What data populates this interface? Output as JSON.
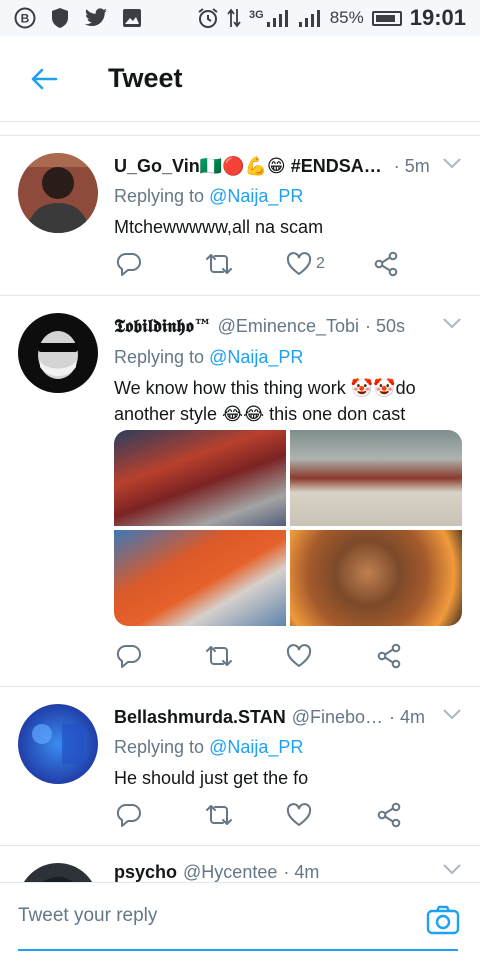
{
  "status_bar": {
    "battery": "85%",
    "time": "19:01",
    "network": "3G"
  },
  "header": {
    "title": "Tweet"
  },
  "tweets": [
    {
      "name": "U_Go_Vin🇳🇬🔴💪😁 #ENDSA…",
      "handle": "",
      "time": "· 5m",
      "replying_label": "Replying to ",
      "replying_to": "@Naija_PR",
      "text": "Mtchewwwww,all na scam",
      "like_count": "2"
    },
    {
      "name": "𝕿𝖔𝖇𝖎𝖑𝖉𝖎𝖓𝖍𝖔™",
      "handle": "@Eminence_Tobi",
      "time": "· 50s",
      "replying_label": "Replying to ",
      "replying_to": "@Naija_PR",
      "text": "We know how this thing work 🤡🤡do another style 😂😂 this one don cast",
      "like_count": ""
    },
    {
      "name": "Bellashmurda.STAN",
      "handle": "@Finebo…",
      "time": "· 4m",
      "replying_label": "Replying to ",
      "replying_to": "@Naija_PR",
      "text": "He should just get the fo",
      "like_count": ""
    },
    {
      "name": "psycho",
      "handle": "@Hycentee",
      "time": "· 4m"
    }
  ],
  "reply_bar": {
    "placeholder": "Tweet your reply"
  },
  "colors": {
    "accent": "#1da1f2",
    "secondary_text": "#657786",
    "divider": "#e1e8ed"
  },
  "icons": {
    "back": "arrow-left-icon",
    "reply": "reply-icon",
    "retweet": "retweet-icon",
    "like": "heart-icon",
    "share": "share-icon",
    "caret": "chevron-down-icon",
    "camera": "camera-icon"
  }
}
